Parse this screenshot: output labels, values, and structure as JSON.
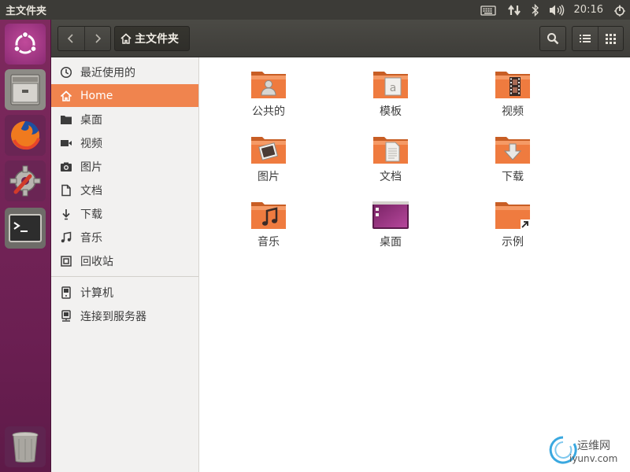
{
  "top_panel": {
    "window_title": "主文件夹",
    "clock": "20:16",
    "indicators": [
      "keyboard-icon",
      "network-icon",
      "bluetooth-icon",
      "volume-icon",
      "power-icon"
    ]
  },
  "launcher": {
    "items": [
      "ubuntu-logo-icon",
      "file-manager-icon",
      "firefox-icon",
      "system-settings-icon",
      "terminal-icon",
      "trash-icon"
    ]
  },
  "headerbar": {
    "path_label": "主文件夹"
  },
  "sidebar": {
    "items": [
      {
        "label": "最近使用的",
        "icon": "clock-icon"
      },
      {
        "label": "Home",
        "icon": "home-icon"
      },
      {
        "label": "桌面",
        "icon": "folder-icon"
      },
      {
        "label": "视频",
        "icon": "video-icon"
      },
      {
        "label": "图片",
        "icon": "camera-icon"
      },
      {
        "label": "文档",
        "icon": "document-icon"
      },
      {
        "label": "下载",
        "icon": "download-icon"
      },
      {
        "label": "音乐",
        "icon": "music-icon"
      },
      {
        "label": "回收站",
        "icon": "trash-icon"
      }
    ],
    "items2": [
      {
        "label": "计算机",
        "icon": "computer-icon"
      },
      {
        "label": "连接到服务器",
        "icon": "server-icon"
      }
    ],
    "active_color": "#f0844e"
  },
  "folders": [
    {
      "label": "公共的",
      "emblem": "person"
    },
    {
      "label": "模板",
      "emblem": "template"
    },
    {
      "label": "视频",
      "emblem": "film"
    },
    {
      "label": "图片",
      "emblem": "photo"
    },
    {
      "label": "文档",
      "emblem": "doc"
    },
    {
      "label": "下载",
      "emblem": "download"
    },
    {
      "label": "音乐",
      "emblem": "music"
    },
    {
      "label": "桌面",
      "emblem": "desktop"
    },
    {
      "label": "示例",
      "emblem": "link"
    }
  ],
  "watermark": {
    "line1": "运维网",
    "line2": "iyunv.com"
  },
  "colors": {
    "accent": "#f0844e",
    "launcher": "#7e2a5e",
    "folder": "#e8753a"
  }
}
